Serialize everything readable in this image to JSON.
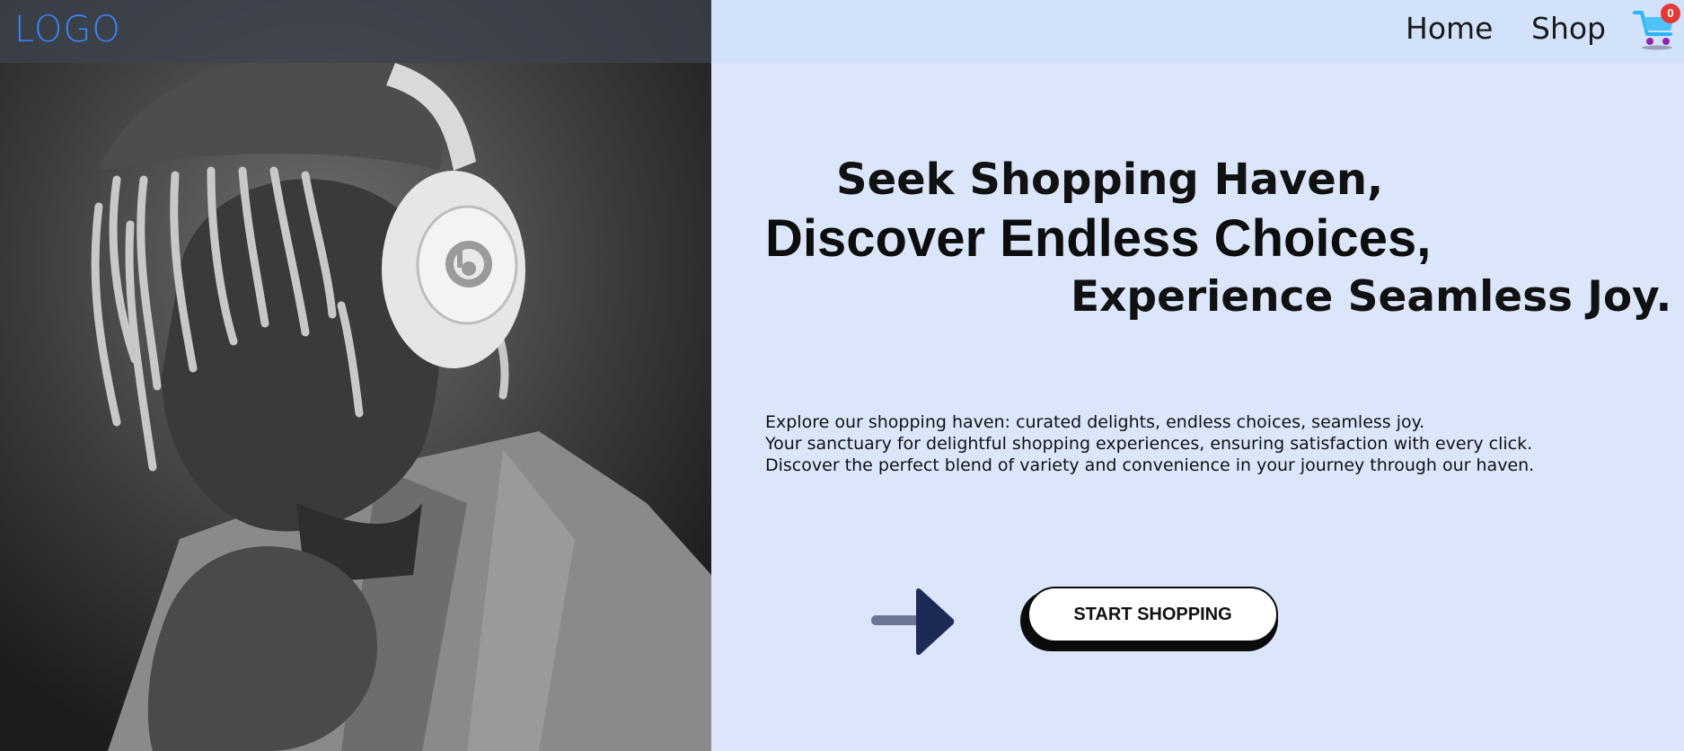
{
  "nav": {
    "logo": "LOGO",
    "links": [
      "Home",
      "Shop"
    ],
    "cart": {
      "icon": "shopping-cart-icon",
      "count": "0",
      "badge_color": "#e53935"
    }
  },
  "hero": {
    "headline_1": "Seek Shopping Haven,",
    "headline_2": "Discover Endless Choices,",
    "headline_3": "Experience Seamless Joy.",
    "description": [
      "Explore our shopping haven: curated delights, endless choices, seamless joy.",
      "Your sanctuary for delightful shopping experiences, ensuring satisfaction with every click.",
      "Discover the perfect blend of variety and convenience in your journey through our haven."
    ],
    "cta_label": "START SHOPPING",
    "cta_arrow_icon": "arrow-right-icon"
  },
  "colors": {
    "background": "#dbe6fb",
    "logo": "#3b82f6",
    "arrow": "#1c2a55",
    "cta_shadow": "#0b0b0b"
  }
}
